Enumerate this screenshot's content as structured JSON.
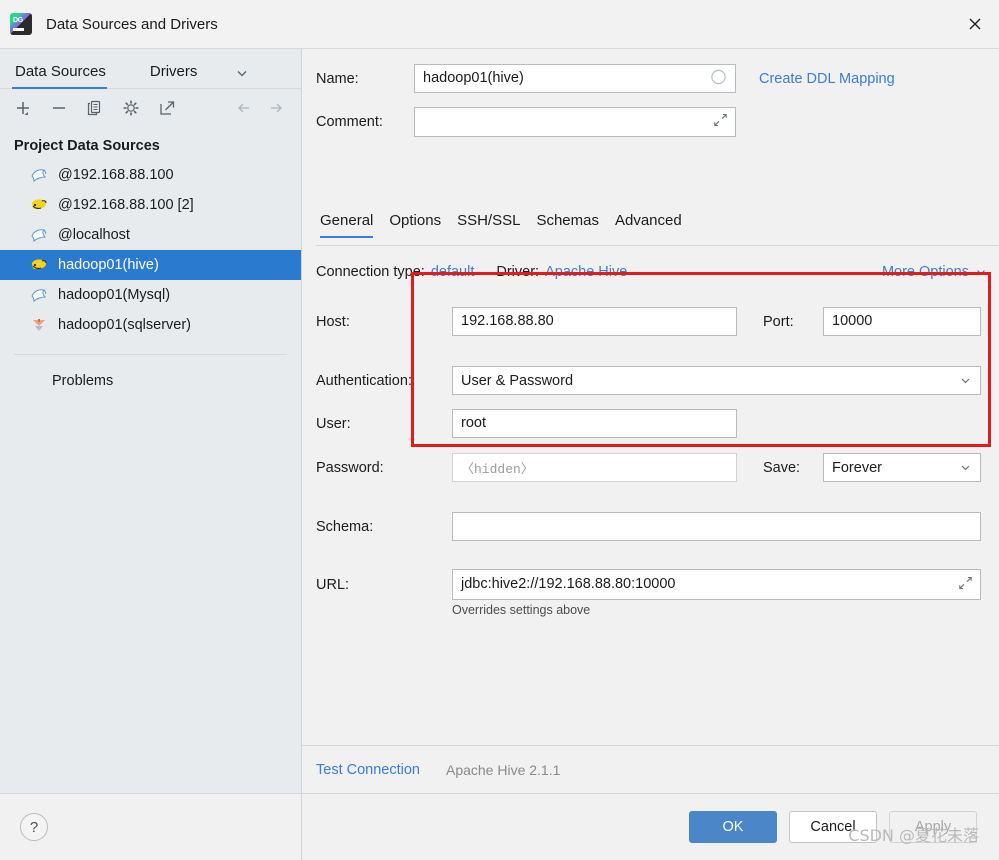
{
  "window": {
    "title": "Data Sources and Drivers",
    "logo_icon": "datagrip-logo-icon",
    "close_icon": "close-icon"
  },
  "sidebar": {
    "tabs": [
      {
        "label": "Data Sources",
        "active": true
      },
      {
        "label": "Drivers",
        "active": false
      }
    ],
    "chevron_icon": "chevron-down-icon",
    "toolbar": [
      {
        "name": "add-data-source-button",
        "icon": "plus-icon"
      },
      {
        "name": "remove-data-source-button",
        "icon": "minus-icon"
      },
      {
        "name": "duplicate-data-source-button",
        "icon": "copy-icon"
      },
      {
        "name": "settings-button",
        "icon": "gear-icon"
      },
      {
        "name": "open-external-button",
        "icon": "external-link-icon"
      },
      {
        "name": "navigate-back-button",
        "icon": "arrow-left-icon"
      },
      {
        "name": "navigate-forward-button",
        "icon": "arrow-right-icon"
      }
    ],
    "section_title": "Project Data Sources",
    "items": [
      {
        "label": "@192.168.88.100",
        "icon": "mysql-dolphin-icon",
        "selected": false
      },
      {
        "label": "@192.168.88.100 [2]",
        "icon": "hive-icon",
        "selected": false
      },
      {
        "label": "@localhost",
        "icon": "mysql-dolphin-icon",
        "selected": false
      },
      {
        "label": "hadoop01(hive)",
        "icon": "hive-icon",
        "selected": true
      },
      {
        "label": "hadoop01(Mysql)",
        "icon": "mysql-dolphin-icon",
        "selected": false
      },
      {
        "label": "hadoop01(sqlserver)",
        "icon": "sqlserver-icon",
        "selected": false
      }
    ],
    "problems_label": "Problems",
    "help_label": "?"
  },
  "main": {
    "name_label": "Name:",
    "name_value": "hadoop01(hive)",
    "name_color_icon": "color-circle-icon",
    "create_ddl_link": "Create DDL Mapping",
    "comment_label": "Comment:",
    "comment_value": "",
    "comment_expand_icon": "expand-editor-icon",
    "tabs": [
      {
        "label": "General",
        "active": true
      },
      {
        "label": "Options",
        "active": false
      },
      {
        "label": "SSH/SSL",
        "active": false
      },
      {
        "label": "Schemas",
        "active": false
      },
      {
        "label": "Advanced",
        "active": false
      }
    ],
    "connection_type_label": "Connection type:",
    "connection_type_value": "default",
    "driver_label": "Driver:",
    "driver_value": "Apache Hive",
    "more_options_label": "More Options",
    "more_options_icon": "chevron-down-icon",
    "host_label": "Host:",
    "host_value": "192.168.88.80",
    "port_label": "Port:",
    "port_value": "10000",
    "auth_label": "Authentication:",
    "auth_value": "User & Password",
    "auth_chevron_icon": "chevron-down-icon",
    "user_label": "User:",
    "user_value": "root",
    "password_label": "Password:",
    "password_placeholder": "〈hidden〉",
    "password_value": "",
    "save_label": "Save:",
    "save_value": "Forever",
    "save_chevron_icon": "chevron-down-icon",
    "schema_label": "Schema:",
    "schema_value": "",
    "url_label": "URL:",
    "url_value": "jdbc:hive2://192.168.88.80:10000",
    "url_expand_icon": "expand-editor-icon",
    "url_hint": "Overrides settings above",
    "test_connection_label": "Test Connection",
    "driver_version_label": "Apache Hive 2.1.1",
    "buttons": [
      {
        "label": "OK",
        "style": "primary"
      },
      {
        "label": "Cancel",
        "style": "default"
      },
      {
        "label": "Apply",
        "style": "disabled"
      }
    ]
  },
  "overlay": {
    "highlight_box_color": "#e51b1b",
    "watermark": "CSDN @夏花未落"
  }
}
